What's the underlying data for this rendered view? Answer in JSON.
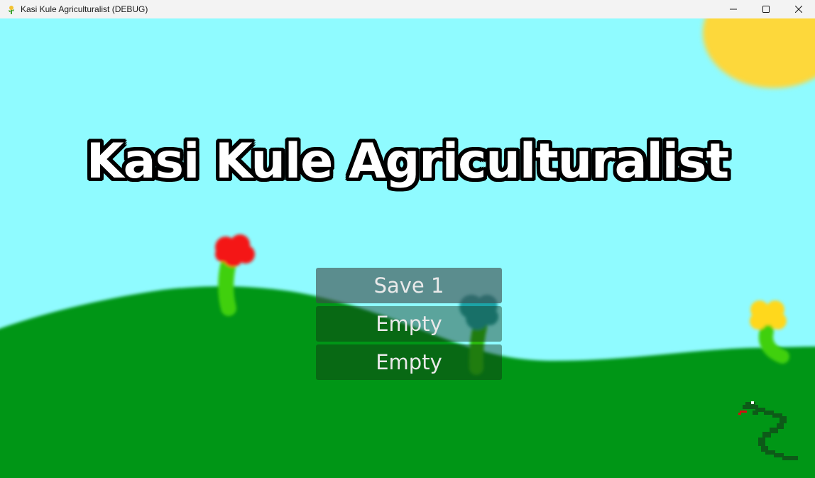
{
  "window": {
    "title": "Kasi Kule Agriculturalist (DEBUG)",
    "controls": {
      "minimize_icon": "minimize-icon",
      "maximize_icon": "maximize-icon",
      "close_icon": "close-icon"
    }
  },
  "game": {
    "title": "Kasi Kule Agriculturalist",
    "save_slots": [
      {
        "label": "Save 1",
        "state": "selected"
      },
      {
        "label": "Empty",
        "state": "normal"
      },
      {
        "label": "Empty",
        "state": "normal"
      }
    ]
  },
  "colors": {
    "sky": "#8ffbff",
    "grass": "#009614",
    "sun": "#fdd83a",
    "flower_red": "#f41414",
    "flower_yellow": "#ffd81e",
    "flower_teal": "#1fa3a6",
    "stem": "#3fd00e",
    "snake": "#0d5a18"
  }
}
